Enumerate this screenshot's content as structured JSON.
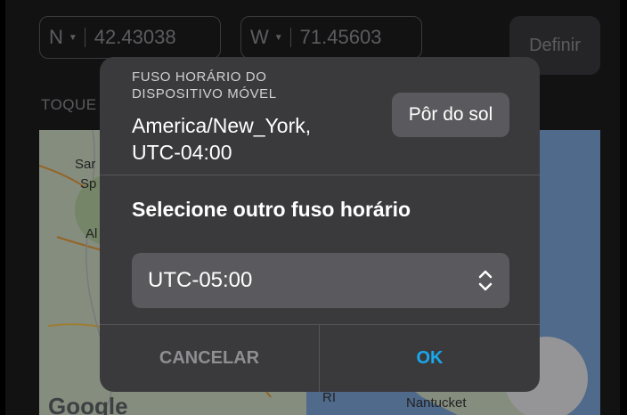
{
  "coordinates": {
    "lat_hemisphere": "N",
    "lat_value": "42.43038",
    "lon_hemisphere": "W",
    "lon_value": "71.45603",
    "define_label": "Definir"
  },
  "map": {
    "hint_text": "TOQUE",
    "labels": [
      "Sar",
      "Sp",
      "Al",
      "RI",
      "Nantucket"
    ],
    "attribution": "Google",
    "locate_icon": "crosshair-icon"
  },
  "dialog": {
    "tz_caption": "FUSO HORÁRIO DO DISPOSITIVO MÓVEL",
    "tz_value_line1": "America/New_York,",
    "tz_value_line2": "UTC-04:00",
    "sunset_label": "Pôr do sol",
    "select_title": "Selecione outro fuso horário",
    "selected_timezone": "UTC-05:00",
    "cancel_label": "CANCELAR",
    "ok_label": "OK"
  },
  "colors": {
    "dialog_bg": "#3a3a3c",
    "accent_ok": "#1aa7ec"
  }
}
